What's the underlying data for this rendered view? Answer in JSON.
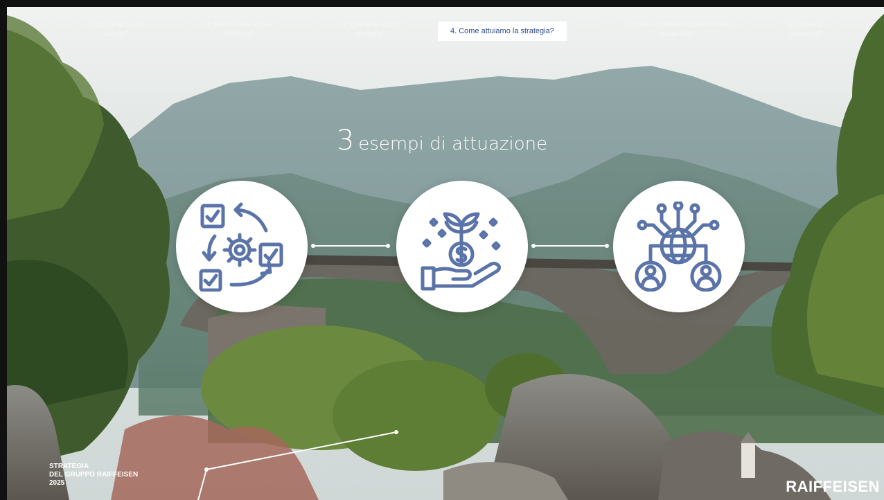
{
  "nav": {
    "items": [
      {
        "label": "1. Qual è la nostra\nvisione?",
        "active": false
      },
      {
        "label": "2. Perché una nuova\nstrategia?",
        "active": false
      },
      {
        "label": "3. Qual è la nostra\nstrategia?",
        "active": false
      },
      {
        "label": "4. Come attuiamo la strategia?",
        "active": true
      },
      {
        "label": "5. Come ci differenziamo in modo\nsostenibile?",
        "active": false
      },
      {
        "label": "6. Come si\nprosegue?",
        "active": false
      }
    ]
  },
  "title": {
    "number": "3",
    "text": "esempi di attuazione"
  },
  "examples": [
    {
      "icon": "process-cycle-icon"
    },
    {
      "icon": "investment-growth-icon"
    },
    {
      "icon": "global-network-icon"
    }
  ],
  "footer": {
    "strategy_label_lines": [
      "STRATEGIA",
      "DEL GRUPPO RAIFFEISEN",
      "2025"
    ],
    "brand": "RAIFFEISEN"
  },
  "colors": {
    "icon": "#5a73a8",
    "active_nav_text": "#2f4a8a"
  }
}
